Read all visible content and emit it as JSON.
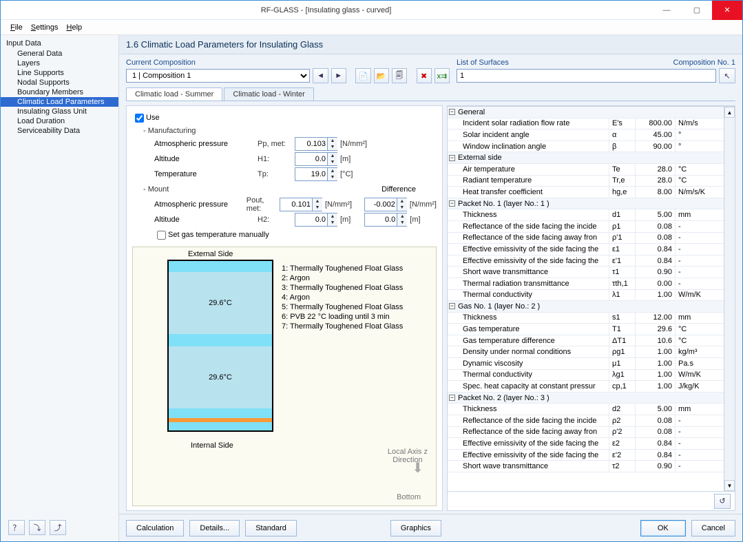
{
  "window": {
    "title": "RF-GLASS - [Insulating glass - curved]"
  },
  "menu": {
    "file": "File",
    "settings": "Settings",
    "help": "Help"
  },
  "sidebar": {
    "header": "Input Data",
    "items": [
      {
        "label": "General Data"
      },
      {
        "label": "Layers"
      },
      {
        "label": "Line Supports"
      },
      {
        "label": "Nodal Supports"
      },
      {
        "label": "Boundary Members"
      },
      {
        "label": "Climatic Load Parameters"
      },
      {
        "label": "Insulating Glass Unit"
      },
      {
        "label": "Load Duration"
      },
      {
        "label": "Serviceability Data"
      }
    ]
  },
  "header": "1.6 Climatic Load Parameters for Insulating Glass",
  "comp": {
    "label": "Current Composition",
    "selected": "1 | Composition 1",
    "surf_label": "List of Surfaces",
    "compno": "Composition No. 1",
    "surf_value": "1"
  },
  "tabs": {
    "summer": "Climatic load - Summer",
    "winter": "Climatic load - Winter"
  },
  "use": "Use",
  "manu": {
    "header": "- Manufacturing",
    "p_label": "Atmospheric pressure",
    "p_sym": "Pp, met:",
    "p_val": "0.103",
    "p_unit": "[N/mm²]",
    "h_label": "Altitude",
    "h_sym": "H1:",
    "h_val": "0.0",
    "h_unit": "[m]",
    "t_label": "Temperature",
    "t_sym": "Tp:",
    "t_val": "19.0",
    "t_unit": "[°C]"
  },
  "mount": {
    "header": "- Mount",
    "diff": "Difference",
    "p_label": "Atmospheric pressure",
    "p_sym": "Pout, met:",
    "p_val": "0.101",
    "p_unit": "[N/mm²]",
    "p_diff": "-0.002",
    "p_dunit": "[N/mm²]",
    "h_label": "Altitude",
    "h_sym": "H2:",
    "h_val": "0.0",
    "h_unit": "[m]",
    "h_diff": "0.0",
    "h_dunit": "[m]"
  },
  "setgas": "Set gas temperature manually",
  "diagram": {
    "ext": "External Side",
    "int": "Internal Side",
    "t1": "29.6°C",
    "t2": "29.6°C",
    "axis": "Local Axis z\nDirection",
    "bottom": "Bottom",
    "layers": [
      "1: Thermally Toughened Float Glass",
      "2: Argon",
      "3: Thermally Toughened Float Glass",
      "4: Argon",
      "5: Thermally Toughened Float Glass",
      "6: PVB 22 °C loading until 3 min",
      "7: Thermally Toughened Float Glass"
    ]
  },
  "props": [
    {
      "t": "hd",
      "k": "General"
    },
    {
      "k": "Incident solar radiation flow rate",
      "s": "E's",
      "v": "800.00",
      "u": "N/m/s"
    },
    {
      "k": "Solar incident angle",
      "s": "α",
      "v": "45.00",
      "u": "°"
    },
    {
      "k": "Window inclination angle",
      "s": "β",
      "v": "90.00",
      "u": "°"
    },
    {
      "t": "hd",
      "k": "External side"
    },
    {
      "k": "Air temperature",
      "s": "Te",
      "v": "28.0",
      "u": "°C"
    },
    {
      "k": "Radiant temperature",
      "s": "Tr,e",
      "v": "28.0",
      "u": "°C"
    },
    {
      "k": "Heat transfer coefficient",
      "s": "hg,e",
      "v": "8.00",
      "u": "N/m/s/K"
    },
    {
      "t": "hd",
      "k": "Packet No. 1 (layer No.: 1 )"
    },
    {
      "k": "Thickness",
      "s": "d1",
      "v": "5.00",
      "u": "mm"
    },
    {
      "k": "Reflectance of the side facing the incide",
      "s": "ρ1",
      "v": "0.08",
      "u": "-"
    },
    {
      "k": "Reflectance of the side facing away fron",
      "s": "ρ'1",
      "v": "0.08",
      "u": "-"
    },
    {
      "k": "Effective emissivity of the side facing the",
      "s": "ε1",
      "v": "0.84",
      "u": "-"
    },
    {
      "k": "Effective emissivity of the side facing the",
      "s": "ε'1",
      "v": "0.84",
      "u": "-"
    },
    {
      "k": "Short wave transmittance",
      "s": "τ1",
      "v": "0.90",
      "u": "-"
    },
    {
      "k": "Thermal radiation transmittance",
      "s": "τth,1",
      "v": "0.00",
      "u": "-"
    },
    {
      "k": "Thermal conductivity",
      "s": "λ1",
      "v": "1.00",
      "u": "W/m/K"
    },
    {
      "t": "hd",
      "k": "Gas No. 1 (layer No.: 2 )"
    },
    {
      "k": "Thickness",
      "s": "s1",
      "v": "12.00",
      "u": "mm"
    },
    {
      "k": "Gas temperature",
      "s": "T1",
      "v": "29.6",
      "u": "°C"
    },
    {
      "k": "Gas temperature difference",
      "s": "ΔT1",
      "v": "10.6",
      "u": "°C"
    },
    {
      "k": "Density under normal conditions",
      "s": "ρg1",
      "v": "1.00",
      "u": "kg/m³"
    },
    {
      "k": "Dynamic viscosity",
      "s": "μ1",
      "v": "1.00",
      "u": "Pa.s"
    },
    {
      "k": "Thermal conductivity",
      "s": "λg1",
      "v": "1.00",
      "u": "W/m/K"
    },
    {
      "k": "Spec. heat capacity at constant pressur",
      "s": "cp,1",
      "v": "1.00",
      "u": "J/kg/K"
    },
    {
      "t": "hd",
      "k": "Packet No. 2 (layer No.: 3 )"
    },
    {
      "k": "Thickness",
      "s": "d2",
      "v": "5.00",
      "u": "mm"
    },
    {
      "k": "Reflectance of the side facing the incide",
      "s": "ρ2",
      "v": "0.08",
      "u": "-"
    },
    {
      "k": "Reflectance of the side facing away fron",
      "s": "ρ'2",
      "v": "0.08",
      "u": "-"
    },
    {
      "k": "Effective emissivity of the side facing the",
      "s": "ε2",
      "v": "0.84",
      "u": "-"
    },
    {
      "k": "Effective emissivity of the side facing the",
      "s": "ε'2",
      "v": "0.84",
      "u": "-"
    },
    {
      "k": "Short wave transmittance",
      "s": "τ2",
      "v": "0.90",
      "u": "-"
    }
  ],
  "buttons": {
    "calc": "Calculation",
    "details": "Details...",
    "standard": "Standard",
    "graphics": "Graphics",
    "ok": "OK",
    "cancel": "Cancel"
  }
}
